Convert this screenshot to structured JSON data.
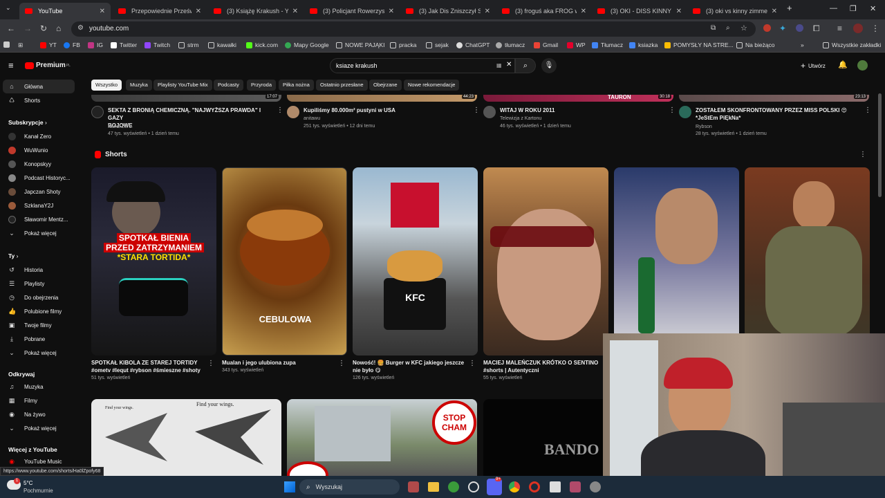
{
  "tabs": [
    {
      "title": "YouTube",
      "active": true
    },
    {
      "title": "Przepowiednie Prześwira"
    },
    {
      "title": "(3) Książę Krakush - YouT"
    },
    {
      "title": "(3) Policjant Rowerzysta, k"
    },
    {
      "title": "(3) Jak Dis Zniszczył Swoje"
    },
    {
      "title": "(3) froguś aka FROG wbija"
    },
    {
      "title": "(3) OKI - DISS KINNY ZIM"
    },
    {
      "title": "(3) oki vs kinny zimmer -"
    }
  ],
  "address": {
    "url": "youtube.com"
  },
  "bookmarks": [
    "YT",
    "FB",
    "IG",
    "Twitter",
    "Twitch",
    "strm",
    "kawałki",
    "kick.com",
    "Mapy Google",
    "NOWE PAJĄKI",
    "pracka",
    "sejak",
    "ChatGPT",
    "tłumacz",
    "Gmail",
    "WP",
    "Tłumacz",
    "ksiazka",
    "POMYSŁY NA STRE...",
    "Na bieżąco",
    "Wszystkie zakładki"
  ],
  "header": {
    "logo": "Premium",
    "region": "PL",
    "search_query": "ksiaze krakush",
    "create_label": "Utwórz"
  },
  "sidebar": {
    "main": [
      {
        "label": "Główna",
        "icon": "home-icon"
      },
      {
        "label": "Shorts",
        "icon": "shorts-icon"
      }
    ],
    "subs_heading": "Subskrypcje",
    "subs": [
      "Kanał Zero",
      "WuWunio",
      "Konopskyy",
      "Podcast Historyc...",
      "Japczan Shoty",
      "SzklanaY2J",
      "Sławomir Mentz..."
    ],
    "show_more": "Pokaż więcej",
    "you_heading": "Ty",
    "you": [
      "Historia",
      "Playlisty",
      "Do obejrzenia",
      "Polubione filmy",
      "Twoje filmy",
      "Pobrane",
      "Pokaż więcej"
    ],
    "explore_heading": "Odkrywaj",
    "explore": [
      "Muzyka",
      "Filmy",
      "Na żywo",
      "Pokaż więcej"
    ],
    "more_heading": "Więcej z YouTube",
    "more": [
      "YouTube Music"
    ]
  },
  "chips": [
    "Wszystko",
    "Muzyka",
    "Playlisty YouTube Mix",
    "Podcasty",
    "Przyroda",
    "Piłka nożna",
    "Ostatnio przesłane",
    "Obejrzane",
    "Nowe rekomendacje"
  ],
  "videos": [
    {
      "title": "SEKTA Z BRONIĄ CHEMICZNĄ. \"NAJWYŻSZA PRAWDA\" I GAZY\nBOJOWE",
      "channel": "Kanał Zero",
      "stats": "47 tys. wyświetleń • 1 dzień temu",
      "duration": "17:07"
    },
    {
      "title": "Kupiliśmy 80.000m² pustyni w USA",
      "channel": "anitawu",
      "stats": "251 tys. wyświetleń • 12 dni temu",
      "duration": "44:23"
    },
    {
      "title": "WITAJ W ROKU 2011",
      "channel": "Telewizja z Kartonu",
      "stats": "46 tys. wyświetleń • 1 dzień temu",
      "duration": "30:18"
    },
    {
      "title": "ZOSTAŁEM SKONFRONTOWANY PRZEZ MISS POLSKI 😍\n*JeStEm PiĘkNa*",
      "channel": "Rybson",
      "stats": "28 tys. wyświetleń • 1 dzień temu",
      "duration": "23:13"
    }
  ],
  "thumb_text": {
    "v4": "TAURON"
  },
  "shorts_heading": "Shorts",
  "shorts": [
    {
      "title": "SPOTKAŁ KIBOLA ZE STAREJ TORTIDY #ometv #lequt #rybson #śmieszne #shoty",
      "views": "51 tys. wyświetleń",
      "overlay1": "SPOTKAŁ BIENIA",
      "overlay2": "PRZED ZATRZYMANIEM",
      "overlay3": "*STARA TORTIDA*"
    },
    {
      "title": "Mualan i jego ulubiona zupa",
      "views": "343 tys. wyświetleń",
      "overlay1": "CEBULOWA"
    },
    {
      "title": "Nowość! 🍔 Burger w KFC jakiego jeszcze nie było 😋",
      "views": "126 tys. wyświetleń",
      "overlay1": "KFC"
    },
    {
      "title": "MACIEJ MALEŃCZUK KRÓTKO O SENTINO #shorts | Autentyczni",
      "views": "55 tys. wyświetleń"
    }
  ],
  "bottom_thumbs": {
    "wings1": "Find your wings.",
    "wings2": "Find your wings.",
    "stop1": "STOP",
    "stop2": "CHAM",
    "bando": "BANDO"
  },
  "status_url": "https://www.youtube.com/shorts/Ha0lZpofy68",
  "taskbar": {
    "temp": "5°C",
    "weather": "Pochmurnie",
    "search": "Wyszukaj",
    "badge": "9+",
    "alert": "1"
  },
  "colors": {
    "yt_red": "#ff0000",
    "bg": "#0f0f0f"
  }
}
